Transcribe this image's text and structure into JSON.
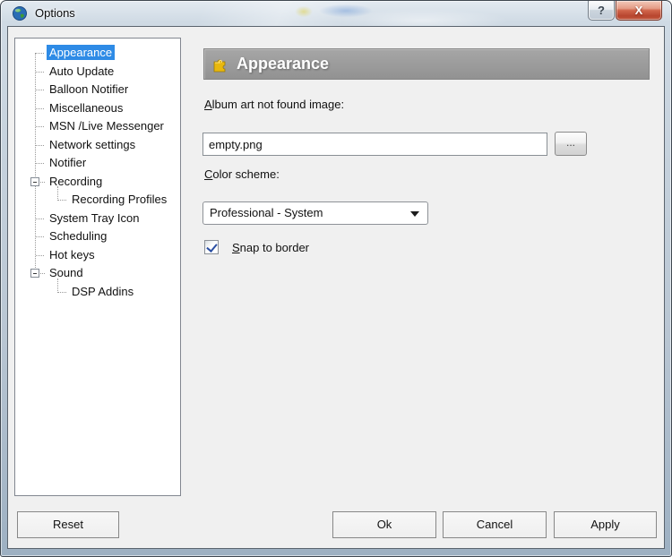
{
  "window": {
    "title": "Options",
    "help_glyph": "?",
    "close_glyph": "X"
  },
  "sidebar": {
    "items": [
      {
        "label": "Appearance",
        "level": 0,
        "selected": true
      },
      {
        "label": "Auto Update",
        "level": 0
      },
      {
        "label": "Balloon Notifier",
        "level": 0
      },
      {
        "label": "Miscellaneous",
        "level": 0
      },
      {
        "label": "MSN /Live Messenger",
        "level": 0
      },
      {
        "label": "Network settings",
        "level": 0
      },
      {
        "label": "Notifier",
        "level": 0
      },
      {
        "label": "Recording",
        "level": 0,
        "expanded": true
      },
      {
        "label": "Recording Profiles",
        "level": 1
      },
      {
        "label": "System Tray Icon",
        "level": 0
      },
      {
        "label": "Scheduling",
        "level": 0
      },
      {
        "label": "Hot keys",
        "level": 0
      },
      {
        "label": "Sound",
        "level": 0,
        "expanded": true
      },
      {
        "label": "DSP Addins",
        "level": 1
      }
    ]
  },
  "main": {
    "header": "Appearance",
    "header_icon": "puzzle-piece",
    "album_art_label": "Album art not found image:",
    "album_art_value": "empty.png",
    "browse_label": "...",
    "color_scheme_label": "Color scheme:",
    "color_scheme_value": "Professional - System",
    "snap_label": "Snap to border",
    "snap_checked": true
  },
  "footer": {
    "reset_label": "Reset",
    "ok_label": "Ok",
    "cancel_label": "Cancel",
    "apply_label": "Apply"
  },
  "colors": {
    "tree_selection": "#2e8be6",
    "header_bar": "#9c9c9c",
    "dialog_bg": "#f0f0f0",
    "close_button_red": "#c2573e",
    "checkmark_blue": "#2b4fa3"
  }
}
